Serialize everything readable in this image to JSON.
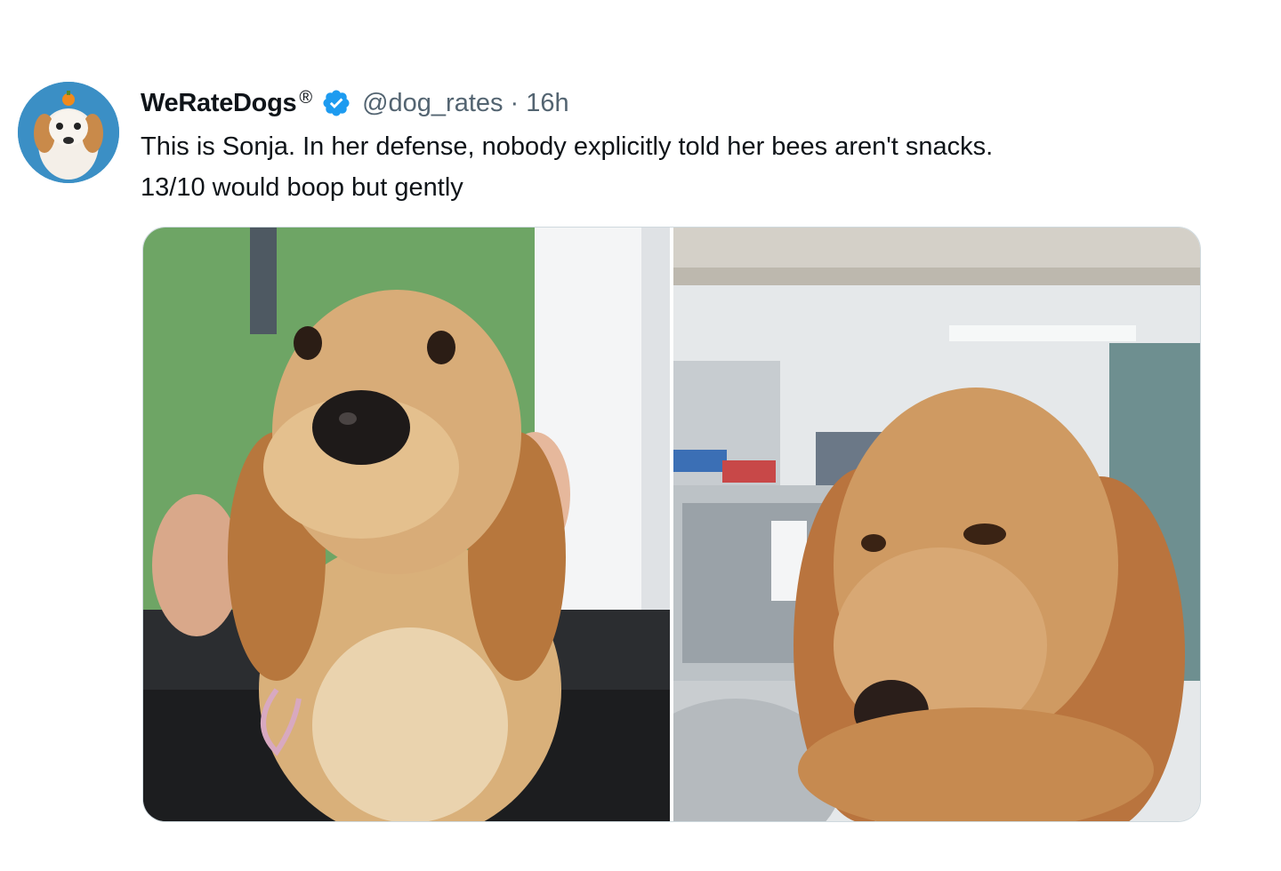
{
  "tweet": {
    "display_name": "WeRateDogs",
    "registered_mark": "®",
    "handle": "@dog_rates",
    "separator": "·",
    "time": "16h",
    "text_line1": "This is Sonja. In her defense, nobody explicitly told her bees aren't snacks.",
    "text_line2": "13/10 would boop but gently"
  },
  "colors": {
    "verified_badge": "#1d9bf0",
    "secondary_text": "#536471",
    "primary_text": "#0f1419"
  },
  "icons": {
    "verified": "verified-badge-icon"
  }
}
